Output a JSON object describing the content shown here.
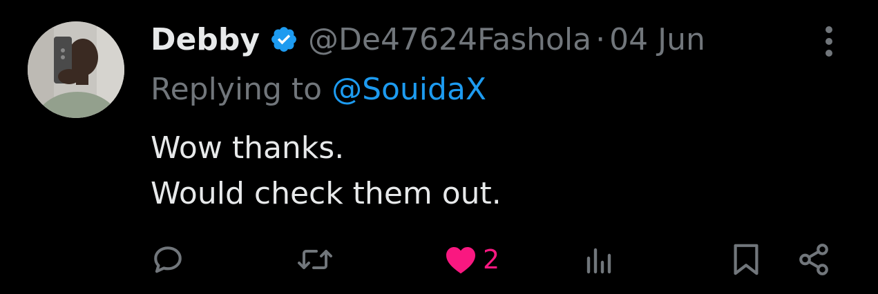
{
  "tweet": {
    "author": {
      "display_name": "Debby",
      "verified": true,
      "verified_color": "#1d9bf0",
      "handle": "@De47624Fashola",
      "avatar_icon": "avatar-photo"
    },
    "separator": "·",
    "date": "04 Jun",
    "replying_prefix": "Replying to",
    "replying_to": "@SouidaX",
    "text_lines": [
      "Wow thanks.",
      "Would check them out."
    ],
    "actions": {
      "reply_icon": "reply-icon",
      "retweet_icon": "retweet-icon",
      "like_icon": "heart-icon",
      "like_count": "2",
      "like_color": "#f91880",
      "liked": true,
      "views_icon": "views-icon",
      "bookmark_icon": "bookmark-icon",
      "share_icon": "share-icon"
    }
  }
}
